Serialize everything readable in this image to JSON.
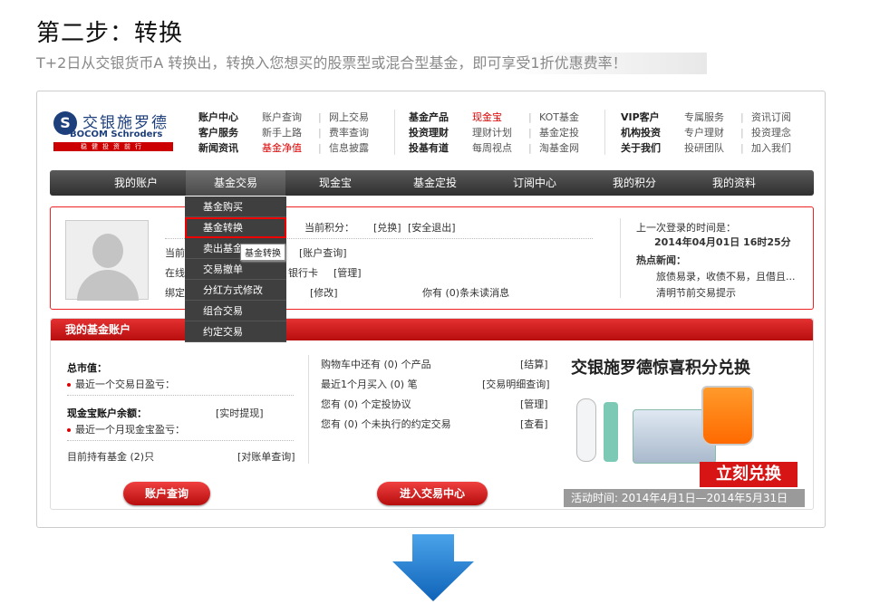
{
  "step": {
    "title": "第二步：转换",
    "subtitle": "T+2日从交银货币A 转换出，转换入您想买的股票型或混合型基金，即可享受1折优惠费率！"
  },
  "logo": {
    "cn": "交银施罗德",
    "en": "BOCOM Schroders",
    "slogan": "稳健投资前行"
  },
  "topnav": {
    "col1": {
      "heads": [
        "账户中心",
        "客户服务",
        "新闻资讯"
      ],
      "links": [
        [
          "账户查询",
          "网上交易"
        ],
        [
          "新手上路",
          "费率查询"
        ],
        [
          "基金净值",
          "信息披露"
        ]
      ]
    },
    "col2": {
      "heads": [
        "基金产品",
        "投资理财",
        "投基有道"
      ],
      "links": [
        [
          "现金宝",
          "KOT基金"
        ],
        [
          "理财计划",
          "基金定投"
        ],
        [
          "每周视点",
          "淘基金网"
        ]
      ]
    },
    "col3": {
      "heads": [
        "VIP客户",
        "机构投资",
        "关于我们"
      ],
      "links": [
        [
          "专属服务",
          "资讯订阅"
        ],
        [
          "专户理财",
          "投资理念"
        ],
        [
          "投研团队",
          "加入我们"
        ]
      ]
    }
  },
  "navbar": [
    "我的账户",
    "基金交易",
    "现金宝",
    "基金定投",
    "订阅中心",
    "我的积分",
    "我的资料"
  ],
  "dropdown": [
    "基金购买",
    "基金转换",
    "卖出基金",
    "交易撤单",
    "分红方式修改",
    "组合交易",
    "约定交易"
  ],
  "tooltip": "基金转换",
  "userinfo": {
    "points_label": "当前积分：",
    "exchange": "[兑换]",
    "logout": "[安全退出]",
    "row2_prefix": "当前",
    "account_query": "[账户查询]",
    "row3_prefix": "在线",
    "bank_card": "银行卡",
    "manage": "[管理]",
    "row4_prefix": "绑定",
    "modify": "[修改]",
    "unread": "你有 (0)条未读消息",
    "last_login_label": "上一次登录的时间是：",
    "last_login_time": "2014年04月01日 16时25分",
    "hot_news_label": "热点新闻：",
    "news1": "旅债易录，收债不易，且借且...",
    "news2": "清明节前交易提示"
  },
  "fund": {
    "header": "我的基金账户",
    "total_label": "总市值：",
    "recent_profit": "最近一个交易日盈亏：",
    "cash_label": "现金宝账户余额：",
    "withdraw": "[实时提现]",
    "recent_month": "最近一个月现金宝盈亏：",
    "holdings": "目前持有基金 (2)只",
    "statement": "[对账单查询]",
    "cart": "购物车中还有 (0) 个产品",
    "checkout": "[结算]",
    "recent_buy": "最近1个月买入 (0) 笔",
    "detail_query": "[交易明细查询]",
    "plans": "您有 (0) 个定投协议",
    "plans_manage": "[管理]",
    "pending": "您有 (0) 个未执行的约定交易",
    "view": "[查看]",
    "btn_account": "账户查询",
    "btn_trade": "进入交易中心"
  },
  "promo": {
    "title": "交银施罗德惊喜积分兑换",
    "cta": "立刻兑换",
    "date": "活动时间: 2014年4月1日—2014年5月31日"
  },
  "colors": {
    "brand_red": "#d00000",
    "nav_dark": "#3f3f3f",
    "arrow_blue": "#1a7bd0"
  }
}
